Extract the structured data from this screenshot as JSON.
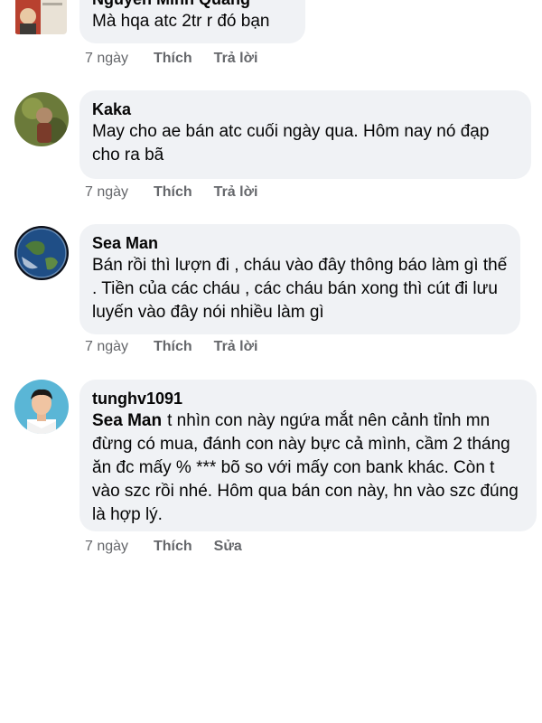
{
  "comments": [
    {
      "author": "Nguyễn Minh Quang",
      "text": "Mà hqa atc 2tr r đó bạn",
      "time": "7 ngày",
      "like": "Thích",
      "reply": "Trả lời"
    },
    {
      "author": "Kaka",
      "text": "May cho ae bán atc cuối ngày qua. Hôm nay nó đạp cho ra bã",
      "time": "7 ngày",
      "like": "Thích",
      "reply": "Trả lời"
    },
    {
      "author": "Sea Man",
      "text": "Bán rồi thì lượn đi , cháu vào đây thông báo làm gì thế . Tiền của các cháu , các cháu bán xong thì cút đi lưu luyến vào đây nói nhiều làm gì",
      "time": "7 ngày",
      "like": "Thích",
      "reply": "Trả lời"
    },
    {
      "author": "tunghv1091",
      "mention": "Sea Man",
      "text": "t nhìn con này ngứa mắt nên cảnh tỉnh mn đừng có mua, đánh con này bực cả mình, cầm 2 tháng ăn đc mấy % *** bõ so với mấy con bank khác. Còn t vào szc rồi nhé. Hôm qua bán con này, hn vào szc đúng là hợp lý.",
      "time": "7 ngày",
      "like": "Thích",
      "edit": "Sửa"
    }
  ],
  "icons": {
    "avatar_1": "avatar-image-icon",
    "avatar_2": "avatar-image-icon",
    "avatar_3": "earth-globe-icon",
    "avatar_4": "person-portrait-icon"
  }
}
